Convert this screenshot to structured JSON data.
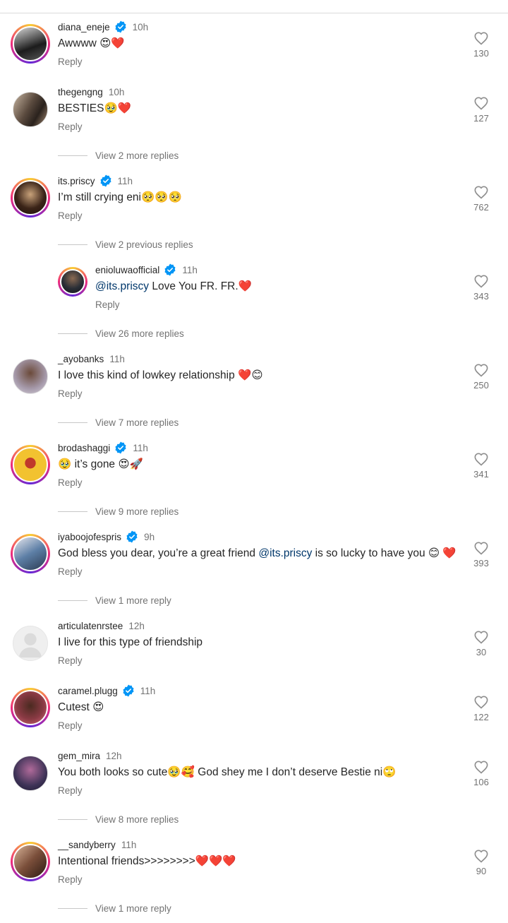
{
  "colors": {
    "verified": "#0095f6",
    "mention": "#00376b",
    "heart_red": "#e0242f"
  },
  "reply_label": "Reply",
  "comments": [
    {
      "username": "diana_eneje",
      "verified": true,
      "time": "10h",
      "text": "Awwww 😍❤️",
      "likes": "130",
      "ring": true,
      "avatar_color": "#1c1c1c"
    },
    {
      "username": "thegengng",
      "verified": false,
      "time": "10h",
      "text": "BESTIES🥹❤️",
      "likes": "127",
      "ring": false,
      "avatar_color": "#5a4a3e"
    },
    {
      "username": "its.priscy",
      "verified": true,
      "time": "11h",
      "text": "I’m still crying eni🥺🥺🥺",
      "likes": "762",
      "ring": true,
      "avatar_color": "#3b2418"
    },
    {
      "username": "enioluwaofficial",
      "verified": true,
      "time": "11h",
      "mention": "@its.priscy",
      "text": " Love You FR. FR.❤️",
      "likes": "343",
      "ring": true,
      "avatar_color": "#2a2e36"
    },
    {
      "username": "_ayobanks",
      "verified": false,
      "time": "11h",
      "text": "I love this kind of lowkey relationship ❤️😊",
      "likes": "250",
      "ring": false,
      "avatar_color": "#6d5a6b"
    },
    {
      "username": "brodashaggi",
      "verified": true,
      "time": "11h",
      "text": "🥹 it’s gone 😍🚀",
      "likes": "341",
      "ring": true,
      "avatar_color": "#f2c230"
    },
    {
      "username": "iyaboojofespris",
      "verified": true,
      "time": "9h",
      "text_before": "God bless you dear, you’re a great friend ",
      "mention": "@its.priscy",
      "text": " is so lucky to have you 😊 ❤️",
      "likes": "393",
      "ring": true,
      "avatar_color": "#5d7fa6"
    },
    {
      "username": "articulatenrstee",
      "verified": false,
      "time": "12h",
      "text": "I live for this type of friendship",
      "likes": "30",
      "ring": false,
      "avatar_color": "#dbdbdb"
    },
    {
      "username": "caramel.plugg",
      "verified": true,
      "time": "11h",
      "text": "Cutest 😍",
      "likes": "122",
      "ring": true,
      "avatar_color": "#8a3a44"
    },
    {
      "username": "gem_mira",
      "verified": false,
      "time": "12h",
      "text": "You both looks so cute🥹🥰 God shey me I don’t deserve Bestie ni🙄",
      "likes": "106",
      "ring": false,
      "avatar_color": "#3e3357"
    },
    {
      "username": "__sandyberry",
      "verified": false,
      "time": "11h",
      "text": "Intentional friends>>>>>>>>❤️❤️❤️",
      "likes": "90",
      "ring": true,
      "avatar_color": "#7a4e3a"
    }
  ],
  "view_more": [
    "View 2 more replies",
    "View 2 previous replies",
    "View 26 more replies",
    "View 7 more replies",
    "View 9 more replies",
    "View 1 more reply",
    "View 8 more replies",
    "View 1 more reply"
  ]
}
